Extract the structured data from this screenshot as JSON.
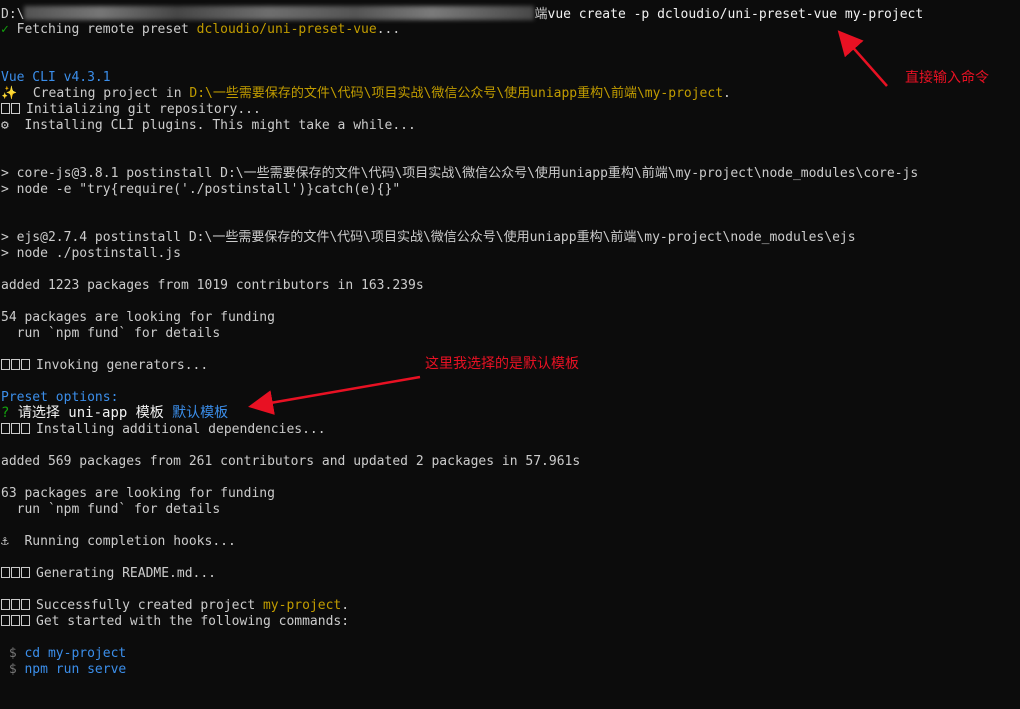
{
  "terminal": {
    "prompt_drive": "D:\\",
    "prompt_tail": "端",
    "command": "vue create -p dcloudio/uni-preset-vue my-project",
    "check_mark": "✓",
    "fetching_label": " Fetching remote preset ",
    "fetching_preset": "dcloudio/uni-preset-vue",
    "ellipsis": "...",
    "vue_cli_version": "Vue CLI v4.3.1",
    "creating_label": "  Creating project in ",
    "creating_path": "D:\\一些需要保存的文件\\代码\\项目实战\\微信公众号\\使用uniapp重构\\前端\\my-project",
    "period": ".",
    "init_git": "Initializing git repository...",
    "installing_plugins": "  Installing CLI plugins. This might take a while...",
    "corejs_line": "> core-js@3.8.1 postinstall D:\\一些需要保存的文件\\代码\\项目实战\\微信公众号\\使用uniapp重构\\前端\\my-project\\node_modules\\core-js",
    "corejs_cmd": "> node -e \"try{require('./postinstall')}catch(e){}\"",
    "ejs_line": "> ejs@2.7.4 postinstall D:\\一些需要保存的文件\\代码\\项目实战\\微信公众号\\使用uniapp重构\\前端\\my-project\\node_modules\\ejs",
    "ejs_cmd": "> node ./postinstall.js",
    "added_1": "added 1223 packages from 1019 contributors in 163.239s",
    "funding_1a": "54 packages are looking for funding",
    "funding_1b": "  run `npm fund` for details",
    "invoking": "Invoking generators...",
    "preset_options": "Preset options:",
    "question_mark": "?",
    "choose_template": " 请选择 uni-app 模板 ",
    "default_template": "默认模板",
    "installing_deps": "Installing additional dependencies...",
    "added_2": "added 569 packages from 261 contributors and updated 2 packages in 57.961s",
    "funding_2a": "63 packages are looking for funding",
    "funding_2b": "  run `npm fund` for details",
    "anchor": "⚓",
    "completion_hooks": "  Running completion hooks...",
    "generating_readme": "Generating README.md...",
    "success_label": "Successfully created project ",
    "success_project": "my-project",
    "get_started": "Get started with the following commands:",
    "dollar": " $ ",
    "cmd_cd": "cd my-project",
    "cmd_serve": "npm run serve"
  },
  "annotations": {
    "command_note": "直接输入命令",
    "template_note": "这里我选择的是默认模板",
    "color": "#e81123"
  }
}
